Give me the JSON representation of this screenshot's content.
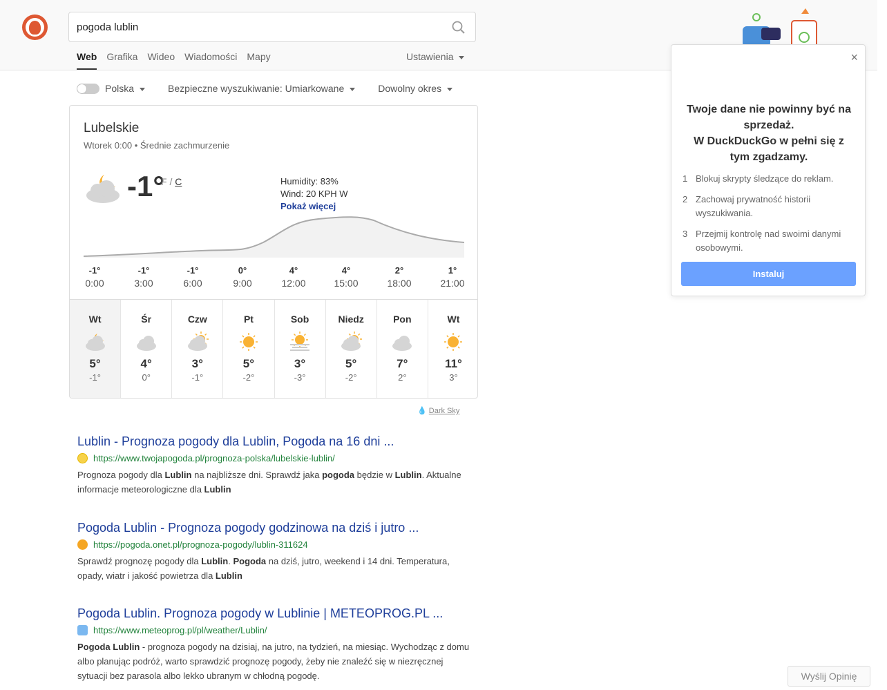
{
  "search": {
    "query": "pogoda lublin"
  },
  "nav": {
    "tabs": [
      "Web",
      "Grafika",
      "Wideo",
      "Wiadomości",
      "Mapy"
    ],
    "settings": "Ustawienia"
  },
  "filters": {
    "region": "Polska",
    "safe": "Bezpieczne wyszukiwanie: Umiarkowane",
    "time": "Dowolny okres"
  },
  "weather": {
    "location": "Lubelskie",
    "subtitle": "Wtorek 0:00 • Średnie zachmurzenie",
    "temp": "-1°",
    "unit_f": "F",
    "unit_sep": " / ",
    "unit_c": "C",
    "humidity": "Humidity: 83%",
    "wind": "Wind: 20 KPH W",
    "more": "Pokaż więcej",
    "hourly": [
      {
        "t": "-1°",
        "h": "0:00"
      },
      {
        "t": "-1°",
        "h": "3:00"
      },
      {
        "t": "-1°",
        "h": "6:00"
      },
      {
        "t": "0°",
        "h": "9:00"
      },
      {
        "t": "4°",
        "h": "12:00"
      },
      {
        "t": "4°",
        "h": "15:00"
      },
      {
        "t": "2°",
        "h": "18:00"
      },
      {
        "t": "1°",
        "h": "21:00"
      }
    ],
    "daily": [
      {
        "d": "Wt",
        "hi": "5°",
        "lo": "-1°",
        "icon": "partly-cloudy-night-icon"
      },
      {
        "d": "Śr",
        "hi": "4°",
        "lo": "0°",
        "icon": "cloudy-icon"
      },
      {
        "d": "Czw",
        "hi": "3°",
        "lo": "-1°",
        "icon": "partly-cloudy-day-icon"
      },
      {
        "d": "Pt",
        "hi": "5°",
        "lo": "-2°",
        "icon": "sun-icon"
      },
      {
        "d": "Sob",
        "hi": "3°",
        "lo": "-3°",
        "icon": "fog-icon"
      },
      {
        "d": "Niedz",
        "hi": "5°",
        "lo": "-2°",
        "icon": "partly-cloudy-day-icon"
      },
      {
        "d": "Pon",
        "hi": "7°",
        "lo": "2°",
        "icon": "cloudy-icon"
      },
      {
        "d": "Wt",
        "hi": "11°",
        "lo": "3°",
        "icon": "sun-icon"
      }
    ],
    "attribution": "Dark Sky"
  },
  "results": [
    {
      "title": "Lublin - Prognoza pogody dla Lublin, Pogoda na 16 dni ...",
      "url": "https://www.twojapogoda.pl/prognoza-polska/lubelskie-lublin/",
      "snippet_parts": [
        "Prognoza pogody dla ",
        "Lublin",
        " na najbliższe dni. Sprawdź jaka ",
        "pogoda",
        " będzie w ",
        "Lublin",
        ". Aktualne informacje meteorologiczne dla ",
        "Lublin",
        ""
      ]
    },
    {
      "title": "Pogoda Lublin - Prognoza pogody godzinowa na dziś i jutro ...",
      "url": "https://pogoda.onet.pl/prognoza-pogody/lublin-311624",
      "snippet_parts": [
        "Sprawdź prognozę pogody dla ",
        "Lublin",
        ". ",
        "Pogoda",
        " na dziś, jutro, weekend i 14 dni. Temperatura, opady, wiatr i jakość powietrza dla ",
        "Lublin",
        ""
      ]
    },
    {
      "title": "Pogoda Lublin. Prognoza pogody w Lublinie | METEOPROG.PL ...",
      "url": "https://www.meteoprog.pl/pl/weather/Lublin/",
      "snippet_parts": [
        "",
        "Pogoda Lublin",
        " - prognoza pogody na dzisiaj, na jutro, na tydzień, na miesiąc. Wychodząc z domu albo planując podróż, warto sprawdzić prognozę pogody, żeby nie znaleźć się w niezręcznej sytuacji bez parasola albo lekko ubranym w chłodną pogodę."
      ]
    }
  ],
  "popup": {
    "title_line1": "Twoje dane nie powinny być na",
    "title_line2": "sprzedaż.",
    "title_line3": "W DuckDuckGo w pełni się z",
    "title_line4": "tym zgadzamy.",
    "items": [
      {
        "n": "1",
        "text": "Blokuj skrypty śledzące do reklam."
      },
      {
        "n": "2",
        "text": "Zachowaj prywatność historii wyszukiwania."
      },
      {
        "n": "3",
        "text": "Przejmij kontrolę nad swoimi danymi osobowymi."
      }
    ],
    "install": "Instaluj",
    "close": "×"
  },
  "feedback": "Wyślij Opinię"
}
